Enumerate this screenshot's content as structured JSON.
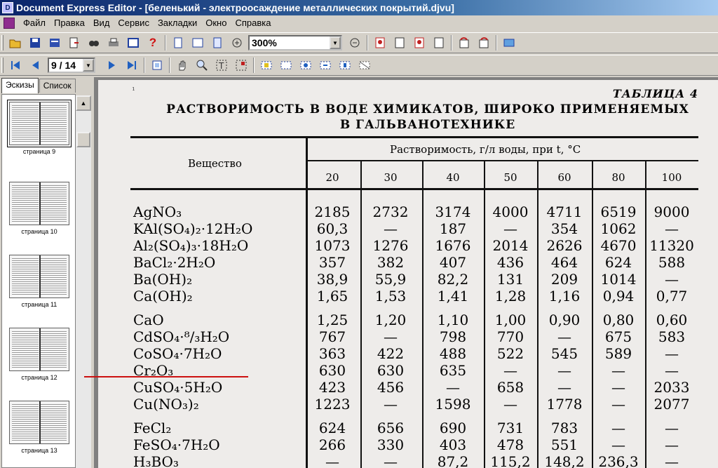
{
  "window": {
    "title": "Document Express Editor - [беленький - электроосаждение металлических покрытий.djvu]"
  },
  "menu": [
    "Файл",
    "Правка",
    "Вид",
    "Сервис",
    "Закладки",
    "Окно",
    "Справка"
  ],
  "toolbar": {
    "zoom_value": "300%",
    "page_value": "9 / 14"
  },
  "left_panel": {
    "tabs": [
      "Эскизы",
      "Список"
    ],
    "thumbnails": [
      "страница 9",
      "страница 10",
      "страница 11",
      "страница 12",
      "страница 13"
    ]
  },
  "document": {
    "page_marker": "¹",
    "table_label": "ТАБЛИЦА 4",
    "title_line1": "РАСТВОРИМОСТЬ В ВОДЕ ХИМИКАТОВ, ШИРОКО ПРИМЕНЯЕМЫХ",
    "title_line2": "В ГАЛЬВАНОТЕХНИКЕ",
    "col_substance": "Вещество",
    "col_solubility": "Растворимость, г/л воды, при t, °C",
    "temperatures": [
      "20",
      "30",
      "40",
      "50",
      "60",
      "80",
      "100"
    ],
    "rows": [
      {
        "name": "AgNO₃",
        "values": [
          "2185",
          "2732",
          "3174",
          "4000",
          "4711",
          "6519",
          "9000"
        ]
      },
      {
        "name": "KAl(SO₄)₂·12H₂O",
        "values": [
          "60,3",
          "—",
          "187",
          "—",
          "354",
          "1062",
          "—"
        ]
      },
      {
        "name": "Al₂(SO₄)₃·18H₂O",
        "values": [
          "1073",
          "1276",
          "1676",
          "2014",
          "2626",
          "4670",
          "11320"
        ]
      },
      {
        "name": "BaCl₂·2H₂O",
        "values": [
          "357",
          "382",
          "407",
          "436",
          "464",
          "624",
          "588"
        ]
      },
      {
        "name": "Ba(OH)₂",
        "values": [
          "38,9",
          "55,9",
          "82,2",
          "131",
          "209",
          "1014",
          "—"
        ]
      },
      {
        "name": "Ca(OH)₂",
        "values": [
          "1,65",
          "1,53",
          "1,41",
          "1,28",
          "1,16",
          "0,94",
          "0,77"
        ]
      },
      {
        "name": "CaO",
        "values": [
          "1,25",
          "1,20",
          "1,10",
          "1,00",
          "0,90",
          "0,80",
          "0,60"
        ]
      },
      {
        "name": "CdSO₄·⁸/₃H₂O",
        "values": [
          "767",
          "—",
          "798",
          "770",
          "—",
          "675",
          "583"
        ]
      },
      {
        "name": "CoSO₄·7H₂O",
        "values": [
          "363",
          "422",
          "488",
          "522",
          "545",
          "589",
          "—"
        ]
      },
      {
        "name": "Cr₂O₃",
        "values": [
          "630",
          "630",
          "635",
          "—",
          "—",
          "—",
          "—"
        ]
      },
      {
        "name": "CuSO₄·5H₂O",
        "values": [
          "423",
          "456",
          "—",
          "658",
          "—",
          "—",
          "2033"
        ]
      },
      {
        "name": "Cu(NO₃)₂",
        "values": [
          "1223",
          "—",
          "1598",
          "—",
          "1778",
          "—",
          "2077"
        ]
      },
      {
        "name": "FeCl₂",
        "values": [
          "624",
          "656",
          "690",
          "731",
          "783",
          "—",
          "—"
        ]
      },
      {
        "name": "FeSO₄·7H₂O",
        "values": [
          "266",
          "330",
          "403",
          "478",
          "551",
          "—",
          "—"
        ]
      },
      {
        "name": "H₃BO₃",
        "values": [
          "—",
          "—",
          "87,2",
          "115,2",
          "148,2",
          "236,3",
          "—"
        ]
      }
    ]
  }
}
